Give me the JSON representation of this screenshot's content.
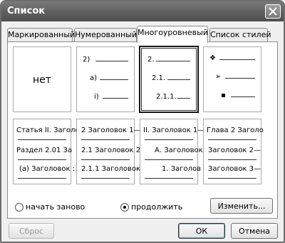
{
  "window": {
    "title": "Список"
  },
  "tabs": [
    {
      "label": "Маркированный"
    },
    {
      "label": "Нумерованный"
    },
    {
      "label": "Многоуровневый"
    },
    {
      "label": "Список стилей"
    }
  ],
  "gallery": {
    "none_label": "нет",
    "cell2": [
      "2)",
      "а)",
      "i)"
    ],
    "cell3": [
      "2.",
      "2.1.",
      "2.1.1."
    ],
    "cell4": [
      "❖",
      "➢",
      "▪"
    ],
    "cell5": [
      "Статья II. Заголо",
      "Раздел 2.01 За",
      "(а) Заголовок :"
    ],
    "cell6": [
      "2 Заголовок 1—",
      "2.1 Заголовок 2-",
      "2.1.1 Заголовок"
    ],
    "cell7": [
      "II. Заголовок 1—",
      "А. Заголовок",
      "1. Заголов"
    ],
    "cell8": [
      "Глава 2 Заголо",
      "Заголовок 2—",
      "Заголовок 3—"
    ]
  },
  "options": {
    "restart_label": "начать заново",
    "continue_label": "продолжить",
    "selected": "continue"
  },
  "buttons": {
    "change": "Изменить...",
    "reset": "Сброс",
    "ok": "ОК",
    "cancel": "Отмена"
  }
}
